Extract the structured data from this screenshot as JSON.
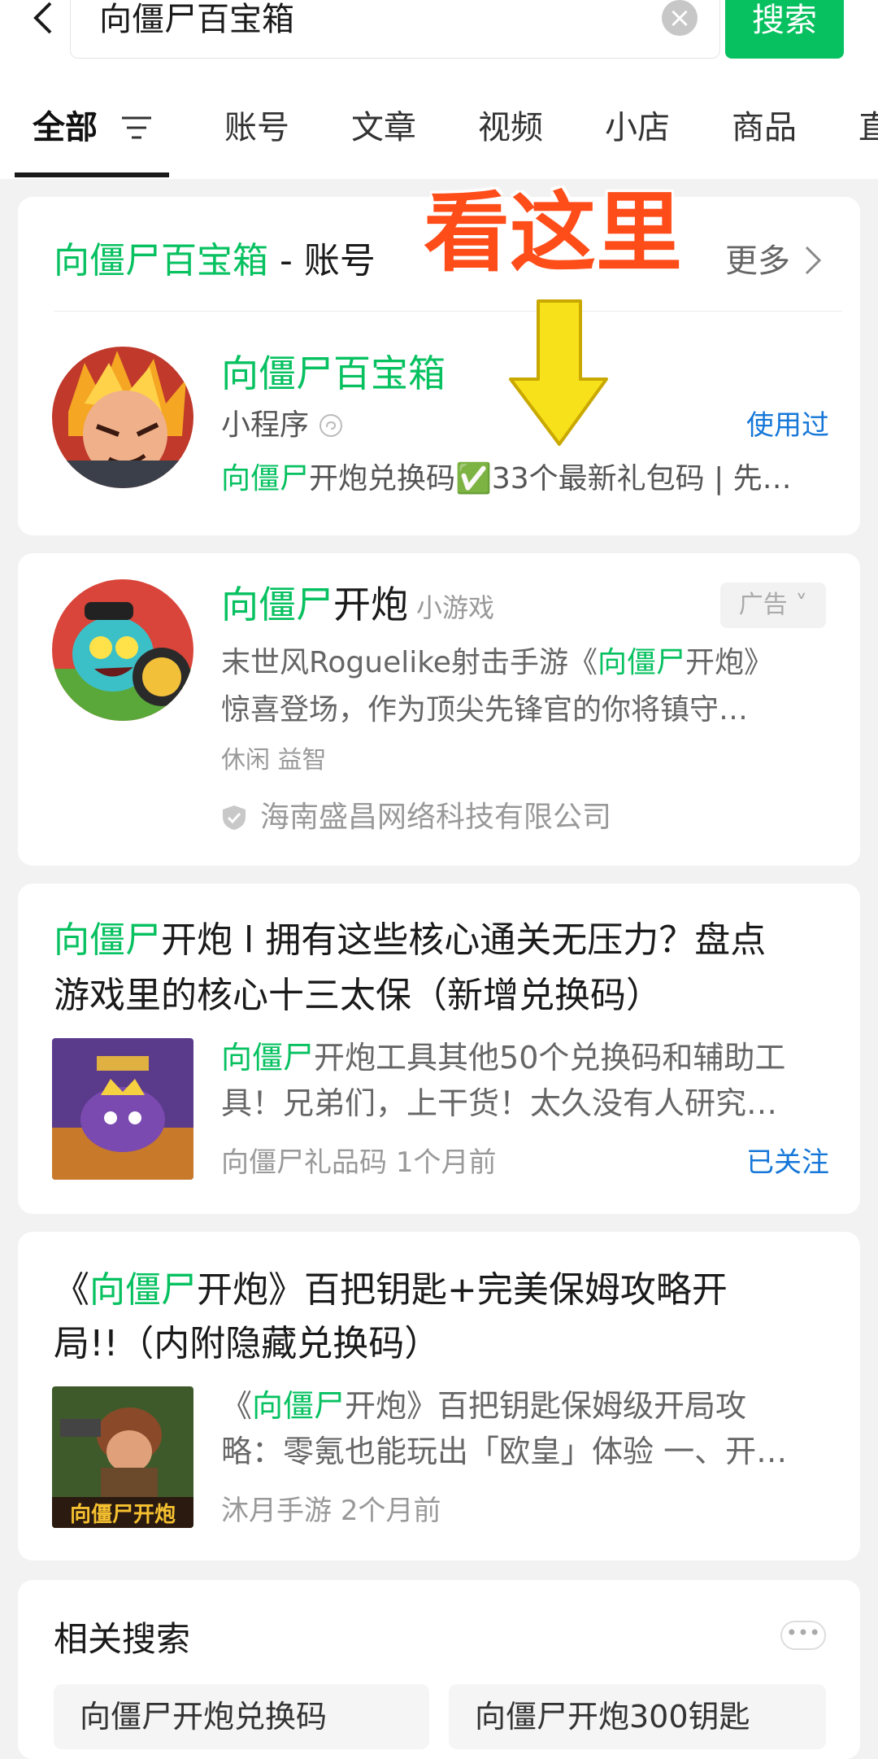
{
  "search": {
    "query": "向僵尸百宝箱",
    "button": "搜索"
  },
  "tabs": [
    "全部",
    "账号",
    "文章",
    "视频",
    "小店",
    "商品",
    "直"
  ],
  "account_section": {
    "title_keyword": "向僵尸百宝箱",
    "title_suffix": " - 账号",
    "more": "更多",
    "overlay_text": "看这里",
    "result": {
      "name": "向僵尸百宝箱",
      "type": "小程序",
      "used": "使用过",
      "desc_keyword": "向僵尸",
      "desc_rest": "开炮兑换码✅33个最新礼包码 | 先…"
    }
  },
  "game_card": {
    "name_keyword": "向僵尸",
    "name_rest": "开炮",
    "type": "小游戏",
    "ad_badge": "广告",
    "desc_line1_pre": "末世风Roguelike射击手游《",
    "desc_line1_keyword": "向僵尸",
    "desc_line1_post": "开炮》",
    "desc_line2": "惊喜登场，作为顶尖先锋官的你将镇守…",
    "tags": "休闲 益智",
    "developer": "海南盛昌网络科技有限公司"
  },
  "articles": [
    {
      "title_keyword": "向僵尸",
      "title_line1_rest": "开炮 l 拥有这些核心通关无压力？盘点",
      "title_line2": "游戏里的核心十三太保（新增兑换码）",
      "snippet_keyword": "向僵尸",
      "snippet_line1_rest": "开炮工具其他50个兑换码和辅助工",
      "snippet_line2": "具！兄弟们，上干货！太久没有人研究…",
      "source": "向僵尸礼品码",
      "time": "1个月前",
      "follow": "已关注"
    },
    {
      "title_pre": "《",
      "title_keyword": "向僵尸",
      "title_line1_rest": "开炮》百把钥匙+完美保姆攻略开",
      "title_line2": "局!!（内附隐藏兑换码）",
      "snippet_pre": "《",
      "snippet_keyword": "向僵尸",
      "snippet_line1_rest": "开炮》百把钥匙保姆级开局攻",
      "snippet_line2": "略：零氪也能玩出「欧皇」体验 一、开…",
      "source": "沐月手游",
      "time": "2个月前",
      "thumb_text": "向僵尸开炮"
    }
  ],
  "related": {
    "title": "相关搜索",
    "items": [
      "向僵尸开炮兑换码",
      "向僵尸开炮300钥匙"
    ]
  },
  "colors": {
    "accent": "#07c160",
    "link": "#1677d8",
    "overlay": "#ff4d1a",
    "arrow": "#f7e11a"
  }
}
